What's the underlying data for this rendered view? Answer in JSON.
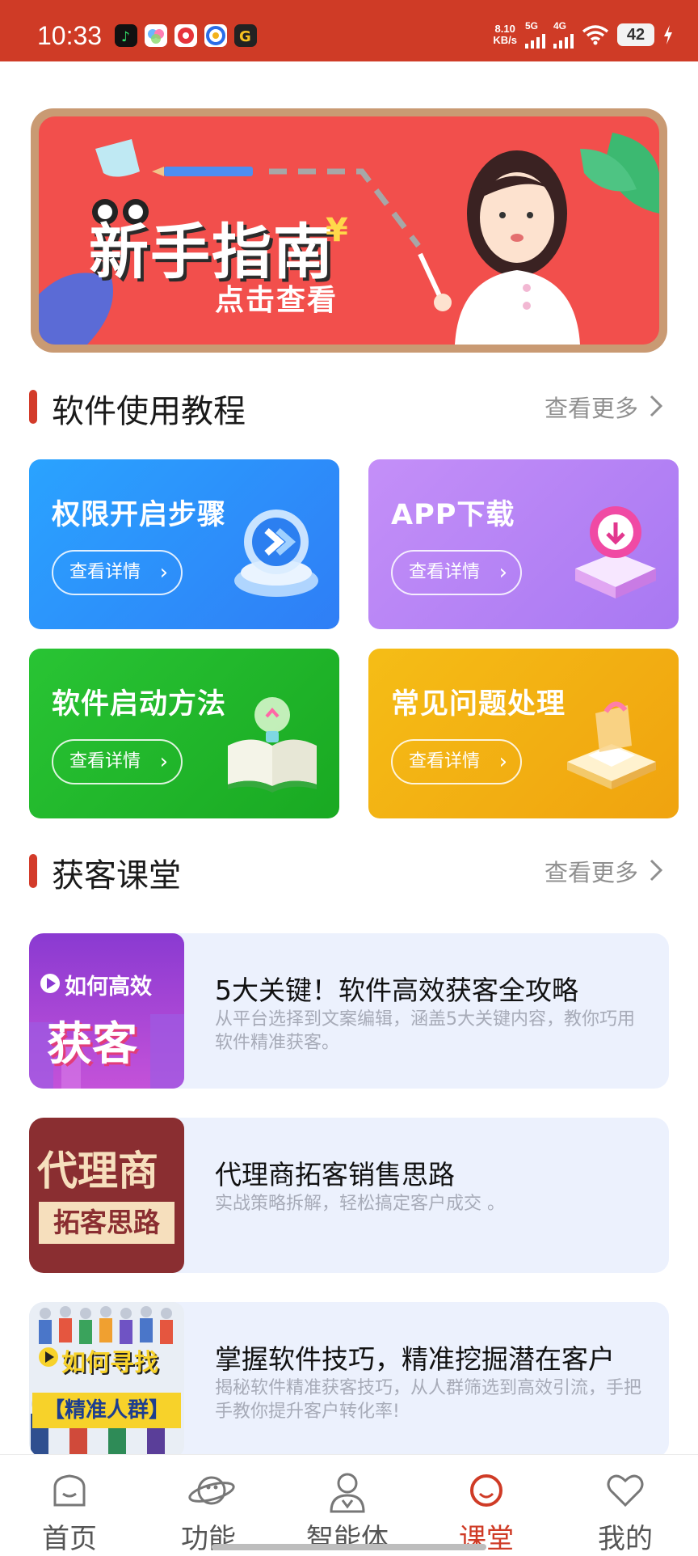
{
  "status_bar": {
    "time": "10:33",
    "net_speed_value": "8.10",
    "net_speed_unit": "KB/s",
    "signal1": "5G",
    "signal2": "4G",
    "battery": "42"
  },
  "banner": {
    "title": "新手指南",
    "yen": "¥",
    "subtitle": "点击查看"
  },
  "tutorials": {
    "title": "软件使用教程",
    "more": "查看更多",
    "cards": [
      {
        "title": "权限开启步骤",
        "button": "查看详情",
        "color": "#2f8ef7"
      },
      {
        "title": "APP下载",
        "button": "查看详情",
        "color": "#b682f5"
      },
      {
        "title": "软件启动方法",
        "button": "查看详情",
        "color": "#21b52a"
      },
      {
        "title": "常见问题处理",
        "button": "查看详情",
        "color": "#f2ae12"
      }
    ]
  },
  "classroom": {
    "title": "获客课堂",
    "more": "查看更多",
    "lessons": [
      {
        "title": "5大关键！软件高效获客全攻略",
        "desc": "从平台选择到文案编辑，涵盖5大关键内容，教你巧用软件精准获客。",
        "thumb_line1": "如何高效",
        "thumb_line2": "获客"
      },
      {
        "title": "代理商拓客销售思路",
        "desc": "实战策略拆解，轻松搞定客户成交 。",
        "thumb_line1": "代理商",
        "thumb_line2": "拓客思路"
      },
      {
        "title": "掌握软件技巧，精准挖掘潜在客户",
        "desc": "揭秘软件精准获客技巧，从人群筛选到高效引流，手把手教你提升客户转化率!",
        "thumb_line1": "如何寻找",
        "thumb_line2": "【精准人群】"
      }
    ]
  },
  "tabbar": {
    "tabs": [
      {
        "label": "首页",
        "icon": "home-icon"
      },
      {
        "label": "功能",
        "icon": "planet-icon"
      },
      {
        "label": "智能体",
        "icon": "person-icon"
      },
      {
        "label": "课堂",
        "icon": "classroom-icon"
      },
      {
        "label": "我的",
        "icon": "heart-icon"
      }
    ],
    "active_index": 3,
    "active_color": "#cf3b26"
  }
}
